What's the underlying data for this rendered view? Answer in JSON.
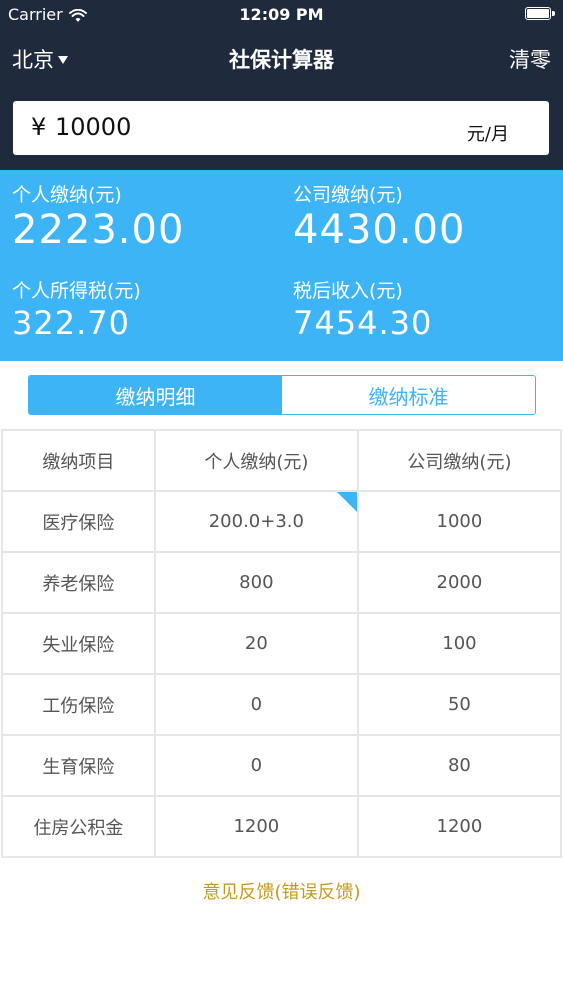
{
  "status_bar": {
    "carrier": "Carrier",
    "time": "12:09 PM"
  },
  "nav": {
    "city": "北京",
    "title": "社保计算器",
    "clear_label": "清零"
  },
  "salary_input": {
    "currency_symbol": "¥",
    "value": "10000",
    "unit": "元/月"
  },
  "summary": {
    "personal_contribution": {
      "label": "个人缴纳(元)",
      "value": "2223.00"
    },
    "company_contribution": {
      "label": "公司缴纳(元)",
      "value": "4430.00"
    },
    "income_tax": {
      "label": "个人所得税(元)",
      "value": "322.70"
    },
    "after_tax_income": {
      "label": "税后收入(元)",
      "value": "7454.30"
    }
  },
  "segment": {
    "tabs": [
      {
        "label": "缴纳明细",
        "active": true
      },
      {
        "label": "缴纳标准",
        "active": false
      }
    ]
  },
  "table": {
    "headers": [
      "缴纳项目",
      "个人缴纳(元)",
      "公司缴纳(元)"
    ],
    "rows": [
      {
        "item": "医疗保险",
        "personal": "200.0+3.0",
        "company": "1000"
      },
      {
        "item": "养老保险",
        "personal": "800",
        "company": "2000"
      },
      {
        "item": "失业保险",
        "personal": "20",
        "company": "100"
      },
      {
        "item": "工伤保险",
        "personal": "0",
        "company": "50"
      },
      {
        "item": "生育保险",
        "personal": "0",
        "company": "80"
      },
      {
        "item": "住房公积金",
        "personal": "1200",
        "company": "1200"
      }
    ]
  },
  "feedback_link": "意见反馈(错误反馈)",
  "colors": {
    "header_bg": "#1f2a3c",
    "accent": "#3db4f5",
    "feedback": "#c49a1c"
  }
}
